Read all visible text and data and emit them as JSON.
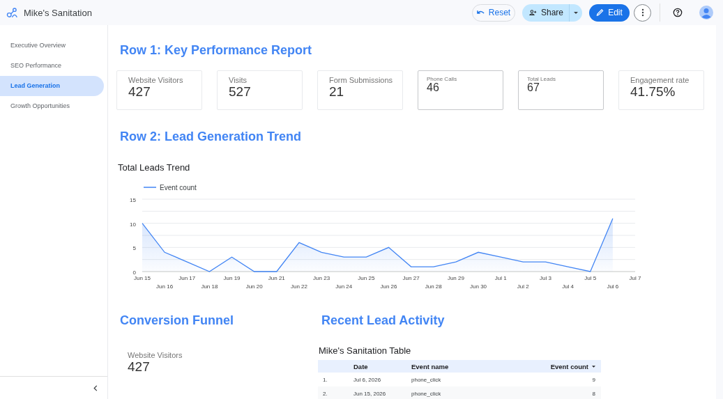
{
  "header": {
    "title": "Mike's Sanitation",
    "buttons": [
      {
        "kind": "reset",
        "label": "Reset"
      },
      {
        "kind": "share",
        "label": "Share"
      },
      {
        "kind": "edit",
        "label": "Edit"
      }
    ]
  },
  "sidebar": {
    "items": [
      {
        "label": "Executive Overview",
        "selected": false
      },
      {
        "label": "SEO Performance",
        "selected": false
      },
      {
        "label": "Lead Generation",
        "selected": true
      },
      {
        "label": "Growth Opportunities",
        "selected": false
      }
    ]
  },
  "row1": {
    "heading": "Row 1: Key Performance Report",
    "cards": [
      {
        "label": "Website Visitors",
        "value": "427",
        "kind": "standard"
      },
      {
        "label": "Visits",
        "value": "527",
        "kind": "standard"
      },
      {
        "label": "Form Submissions",
        "value": "21",
        "kind": "standard"
      },
      {
        "label": "Phone Calls",
        "value": "46",
        "kind": "compact"
      },
      {
        "label": "Total Leads",
        "value": "67",
        "kind": "compact"
      },
      {
        "label": "Engagement rate",
        "value": "41.75%",
        "kind": "standard"
      }
    ]
  },
  "row2": {
    "heading": "Row 2: Lead Generation Trend",
    "chart_title": "Total Leads Trend",
    "chart_data": {
      "type": "area",
      "categories": [
        "Jun 15",
        "Jun 16",
        "Jun 17",
        "Jun 18",
        "Jun 19",
        "Jun 20",
        "Jun 21",
        "Jun 22",
        "Jun 23",
        "Jun 24",
        "Jun 25",
        "Jun 26",
        "Jun 27",
        "Jun 28",
        "Jun 29",
        "Jun 30",
        "Jul 1",
        "Jul 2",
        "Jul 3",
        "Jul 4",
        "Jul 5",
        "Jul 6",
        "Jul 7"
      ],
      "series": [
        {
          "name": "Event count",
          "color": "#4285f4",
          "values": [
            10,
            4,
            2,
            0,
            3,
            0,
            0,
            6,
            4,
            3,
            3,
            5,
            1,
            1,
            2,
            4,
            3,
            2,
            2,
            1,
            0,
            11,
            null
          ]
        }
      ],
      "ylim": [
        0,
        15
      ],
      "yticks": [
        0,
        5,
        10,
        15
      ]
    }
  },
  "funnel": {
    "heading": "Conversion Funnel",
    "label": "Website Visitors",
    "value": "427"
  },
  "activity": {
    "heading": "Recent Lead Activity",
    "table_title": "Mike's Sanitation Table",
    "columns": [
      "Date",
      "Event name",
      "Event count"
    ],
    "rows": [
      {
        "index": "1.",
        "cells": [
          "Jul 6, 2026",
          "phone_click",
          "9"
        ]
      },
      {
        "index": "2.",
        "cells": [
          "Jun 15, 2026",
          "phone_click",
          "8"
        ]
      }
    ]
  }
}
